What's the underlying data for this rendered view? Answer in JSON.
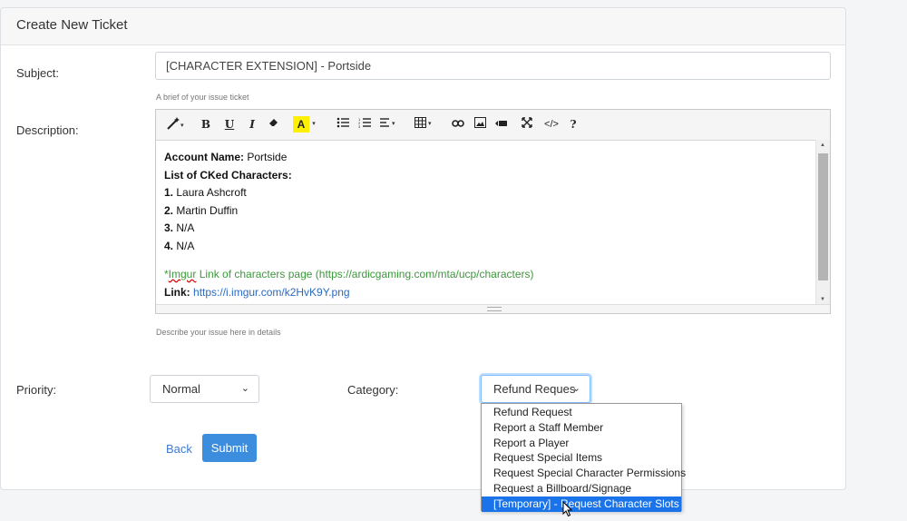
{
  "header": {
    "title": "Create New Ticket"
  },
  "subject": {
    "label": "Subject:",
    "value": "[CHARACTER EXTENSION] - Portside",
    "help": "A brief of your issue ticket"
  },
  "description": {
    "label": "Description:",
    "help": "Describe your issue here in details",
    "toolbar": {
      "bold": "B",
      "underline": "U",
      "italic": "I",
      "highlight": "A",
      "help": "?",
      "code": "</>"
    },
    "content": {
      "account_label": "Account Name:",
      "account_value": "Portside",
      "list_heading": "List of CKed Characters:",
      "items": [
        {
          "num": "1.",
          "name": "Laura Ashcroft"
        },
        {
          "num": "2.",
          "name": "Martin Duffin"
        },
        {
          "num": "3.",
          "name": "N/A"
        },
        {
          "num": "4.",
          "name": "N/A"
        }
      ],
      "imgur_prefix": "*",
      "imgur_word": "Imgur",
      "imgur_rest": " Link of characters page (https://ardicgaming.com/mta/ucp/characters)",
      "link_label": "Link:",
      "link_value": "https://i.imgur.com/k2HvK9Y.png"
    }
  },
  "priority": {
    "label": "Priority:",
    "value": "Normal"
  },
  "category": {
    "label": "Category:",
    "value": "Refund Reques",
    "options": [
      "Refund Request",
      "Report a Staff Member",
      "Report a Player",
      "Request Special Items",
      "Request Special Character Permissions",
      "Request a Billboard/Signage",
      "[Temporary] - Request Character Slots"
    ],
    "highlighted_index": 6
  },
  "actions": {
    "back": "Back",
    "submit": "Submit"
  },
  "colors": {
    "primary": "#3c8dde",
    "highlight": "#1a73e8",
    "link": "#2a6ac0",
    "green_text": "#3a9a3a"
  }
}
